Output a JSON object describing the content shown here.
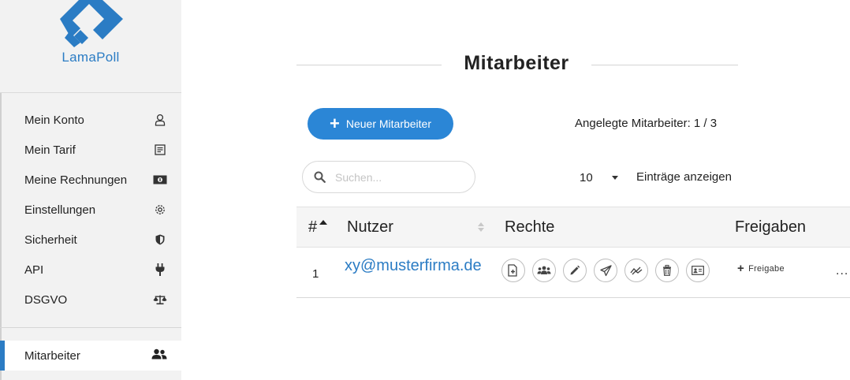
{
  "brand": {
    "name": "LamaPoll",
    "color": "#2b7cc4"
  },
  "sidebar": {
    "items": [
      {
        "label": "Mein Konto",
        "icon": "user-icon"
      },
      {
        "label": "Mein Tarif",
        "icon": "tariff-icon"
      },
      {
        "label": "Meine Rechnungen",
        "icon": "invoice-icon"
      },
      {
        "label": "Einstellungen",
        "icon": "gear-icon"
      },
      {
        "label": "Sicherheit",
        "icon": "shield-icon"
      },
      {
        "label": "API",
        "icon": "plug-icon"
      },
      {
        "label": "DSGVO",
        "icon": "scales-icon"
      }
    ],
    "active": {
      "label": "Mitarbeiter",
      "icon": "users-icon"
    }
  },
  "page": {
    "title": "Mitarbeiter",
    "new_button_label": "Neuer Mitarbeiter",
    "count_text": "Angelegte Mitarbeiter: 1 / 3",
    "search_placeholder": "Suchen...",
    "entries_value": "10",
    "entries_label": "Einträge anzeigen"
  },
  "table": {
    "columns": [
      "#",
      "Nutzer",
      "Rechte",
      "Freigaben"
    ],
    "rows": [
      {
        "index": "1",
        "email": "xy@musterfirma.de",
        "rights_icons": [
          "new-document-icon",
          "group-icon",
          "pencil-icon",
          "paper-plane-icon",
          "chart-icon",
          "trash-icon",
          "id-card-icon"
        ],
        "freigabe_label": "Freigabe",
        "more_label": "..."
      }
    ]
  }
}
